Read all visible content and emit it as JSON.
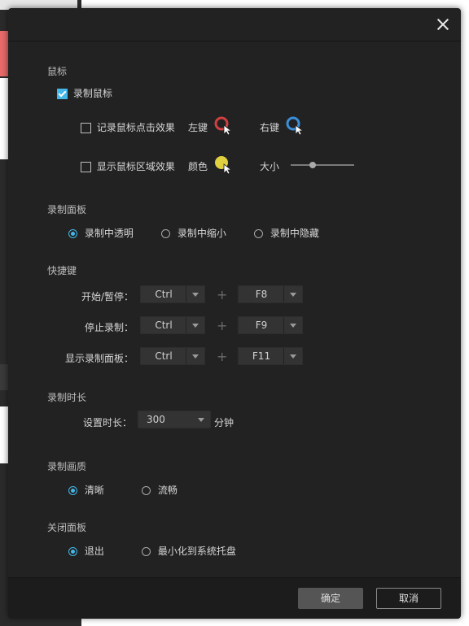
{
  "dialog": {
    "close_label": "×"
  },
  "mouse": {
    "title": "鼠标",
    "record_mouse": {
      "label": "录制鼠标",
      "checked": true
    },
    "record_click": {
      "label": "记录鼠标点击效果",
      "checked": false
    },
    "left_key": "左键",
    "right_key": "右键",
    "show_area": {
      "label": "显示鼠标区域效果",
      "checked": false
    },
    "color_label": "颜色",
    "size_label": "大小",
    "size_value": 0.35,
    "colors": {
      "left": "#d04040",
      "right": "#3a8fd8",
      "area": "#e0d040"
    }
  },
  "panel": {
    "title": "录制面板",
    "options": [
      "录制中透明",
      "录制中缩小",
      "录制中隐藏"
    ],
    "selected": 0
  },
  "hotkeys": {
    "title": "快捷键",
    "rows": [
      {
        "label": "开始/暂停：",
        "mod": "Ctrl",
        "key": "F8"
      },
      {
        "label": "停止录制：",
        "mod": "Ctrl",
        "key": "F9"
      },
      {
        "label": "显示录制面板：",
        "mod": "Ctrl",
        "key": "F11"
      }
    ],
    "plus": "+"
  },
  "duration": {
    "title": "录制时长",
    "label": "设置时长：",
    "value": "300",
    "unit": "分钟"
  },
  "quality": {
    "title": "录制画质",
    "options": [
      "清晰",
      "流畅"
    ],
    "selected": 0
  },
  "close_panel": {
    "title": "关闭面板",
    "options": [
      "退出",
      "最小化到系统托盘"
    ],
    "selected": 0
  },
  "buttons": {
    "ok": "确定",
    "cancel": "取消"
  },
  "colors": {
    "accent": "#43b7e8",
    "dialog_bg": "#222222"
  }
}
